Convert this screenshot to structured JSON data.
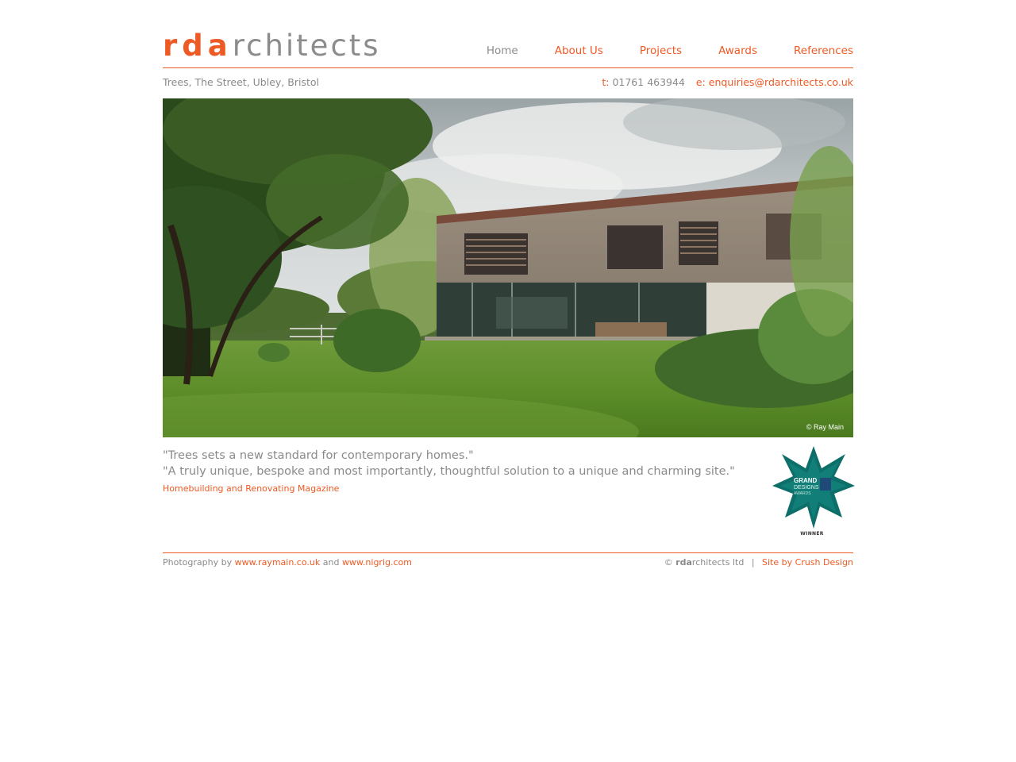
{
  "brand": {
    "logo_prefix": "rda",
    "logo_suffix": "rchitects"
  },
  "nav": {
    "items": [
      {
        "label": "Home",
        "active": true
      },
      {
        "label": "About Us",
        "active": false
      },
      {
        "label": "Projects",
        "active": false
      },
      {
        "label": "Awards",
        "active": false
      },
      {
        "label": "References",
        "active": false
      }
    ]
  },
  "info": {
    "address": "Trees, The Street, Ubley, Bristol",
    "phone_label": "t:",
    "phone": "01761 463944",
    "email_label": "e:",
    "email": "enquiries@rdarchitects.co.uk"
  },
  "hero": {
    "credit": "© Ray Main"
  },
  "testimonial": {
    "quote1": "\"Trees sets a new standard for contemporary homes.\"",
    "quote2": "\"A truly unique, bespoke and most importantly, thoughtful solution to a unique and charming site.\"",
    "source": "Homebuilding and Renovating Magazine"
  },
  "award": {
    "title_line1": "GRAND",
    "title_line2": "DESIGNS",
    "sub": "AWARDS",
    "winner": "WINNER"
  },
  "footer": {
    "photo_prefix": "Photography by",
    "photo_link1": "www.raymain.co.uk",
    "photo_and": "and",
    "photo_link2": "www.nigrig.com",
    "copyright_symbol": "©",
    "copyright_brand_bold": "rda",
    "copyright_brand_rest": "rchitects ltd",
    "separator": "|",
    "site_by": "Site by Crush Design"
  },
  "colors": {
    "accent": "#ee5a24",
    "text_grey": "#8a8a8a",
    "award_teal": "#0e6f6a"
  }
}
